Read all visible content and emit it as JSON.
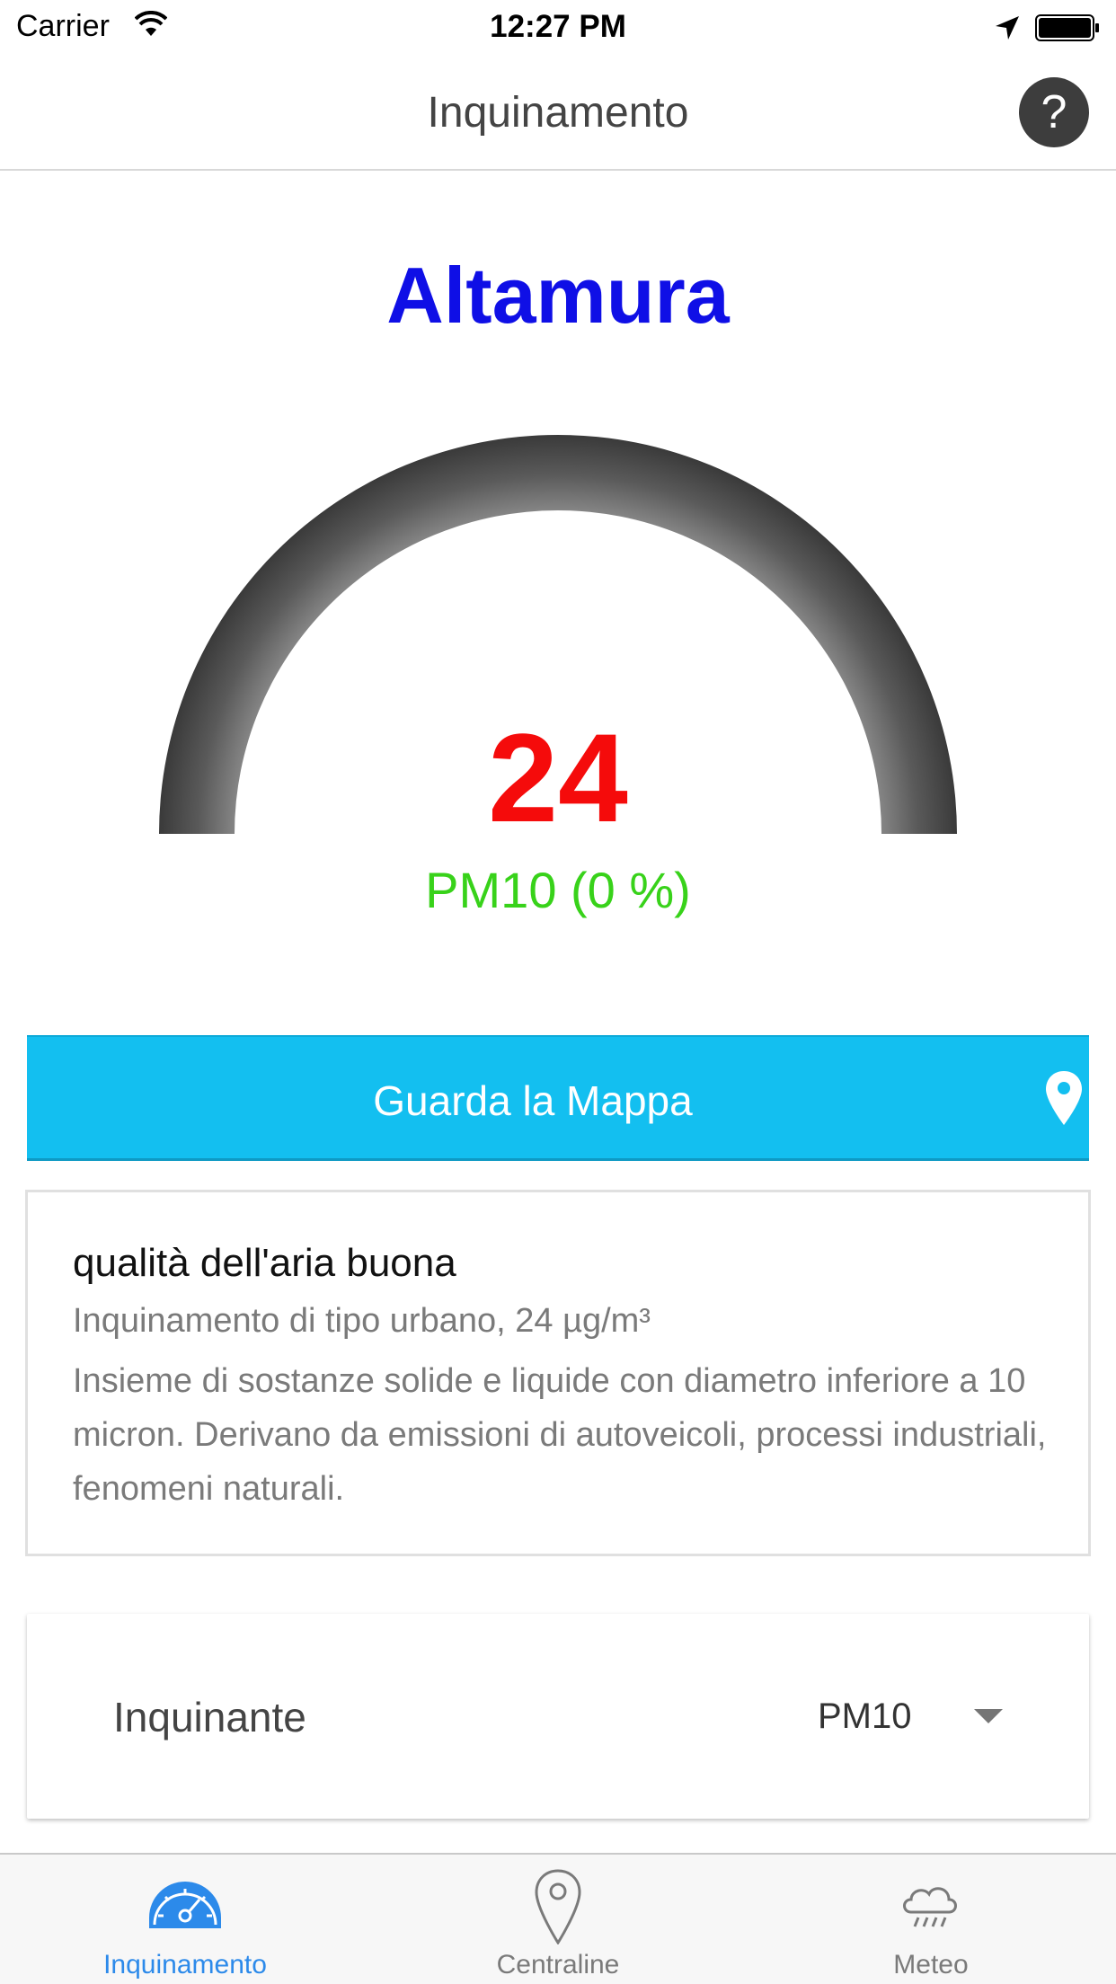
{
  "status_bar": {
    "carrier": "Carrier",
    "time": "12:27 PM"
  },
  "nav": {
    "title": "Inquinamento",
    "help_label": "?"
  },
  "city": "Altamura",
  "gauge": {
    "value": "24",
    "label": "PM10 (0 %)",
    "fill_percent": 0,
    "value_color": "#f50b0b",
    "label_color": "#38d21a"
  },
  "map_button": {
    "label": "Guarda la Mappa",
    "icon": "map-pin-icon",
    "color": "#13bff0"
  },
  "info": {
    "title": "qualità dell'aria buona",
    "subtitle": "Inquinamento di tipo urbano, 24 µg/m³",
    "description": "Insieme di sostanze solide e liquide con diametro inferiore a 10 micron. Derivano da emissioni di autoveicoli, processi industriali, fenomeni naturali."
  },
  "selector": {
    "label": "Inquinante",
    "value": "PM10"
  },
  "tabs": [
    {
      "label": "Inquinamento",
      "icon": "speedometer-icon",
      "active": true
    },
    {
      "label": "Centraline",
      "icon": "location-pin-icon",
      "active": false
    },
    {
      "label": "Meteo",
      "icon": "rain-cloud-icon",
      "active": false
    }
  ],
  "colors": {
    "accent": "#2c8aea",
    "city": "#0f0fe6"
  }
}
